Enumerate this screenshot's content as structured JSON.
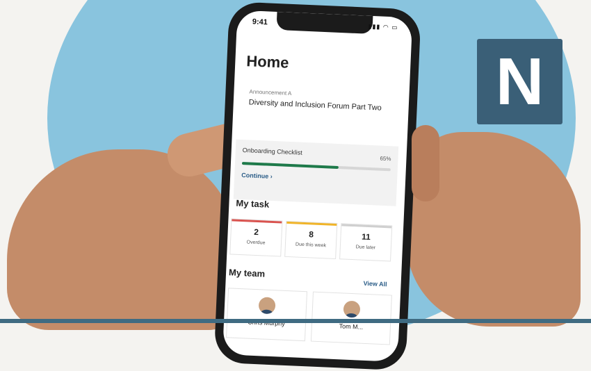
{
  "status": {
    "time": "9:41",
    "icons": "▮▮▮ ◠ ▭"
  },
  "logo": {
    "letter": "N"
  },
  "home": {
    "title": "Home"
  },
  "announcement": {
    "label": "Announcement A",
    "text": "Diversity and Inclusion Forum Part Two"
  },
  "checklist": {
    "title": "Onboarding Checklist",
    "percent": "65%",
    "progress": 0.65,
    "continue": "Continue ›"
  },
  "tasks": {
    "title": "My task",
    "items": [
      {
        "count": "2",
        "label": "Overdue",
        "color": "#d9534f"
      },
      {
        "count": "8",
        "label": "Due this week",
        "color": "#f0b429"
      },
      {
        "count": "11",
        "label": "Due later",
        "color": "#cfcfcf"
      }
    ]
  },
  "team": {
    "title": "My team",
    "view_all": "View All",
    "members": [
      {
        "name": "Chris Murphy"
      },
      {
        "name": "Tom M..."
      }
    ]
  },
  "colors": {
    "background_circle": "#89c4de",
    "logo_bg": "#3a5f77",
    "accent": "#2a5c87",
    "progress": "#1e7a4a"
  }
}
